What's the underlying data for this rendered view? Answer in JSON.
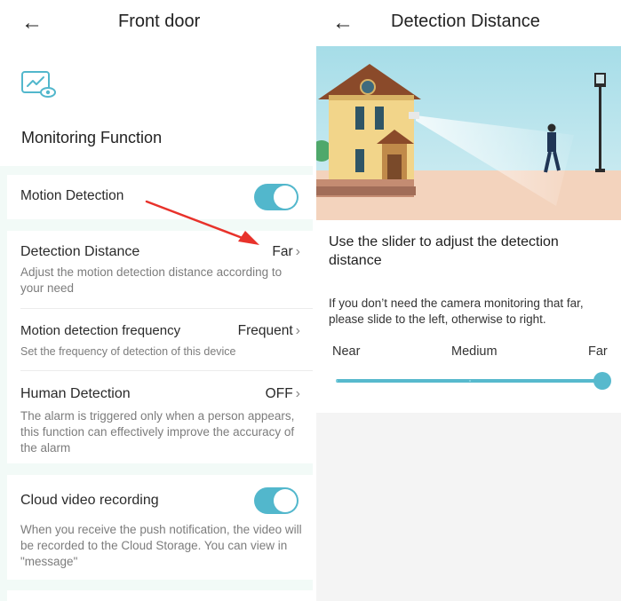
{
  "left": {
    "title": "Front door",
    "section_title": "Monitoring Function",
    "rows": {
      "motion_detection": {
        "title": "Motion Detection",
        "on": true
      },
      "detection_distance": {
        "title": "Detection Distance",
        "value": "Far",
        "desc": "Adjust the motion detection distance according to your need"
      },
      "frequency": {
        "title": "Motion detection frequency",
        "value": "Frequent",
        "desc": "Set the frequency of detection of this device"
      },
      "human_detection": {
        "title": "Human Detection",
        "value": "OFF",
        "desc": "The alarm is triggered only when a person appears, this function can effectively improve the accuracy of the alarm"
      },
      "cloud_recording": {
        "title": "Cloud video recording",
        "on": true,
        "desc": "When you receive the push notification, the video will be recorded to the Cloud Storage. You can view in \"message\""
      }
    }
  },
  "right": {
    "title": "Detection Distance",
    "instruction": "Use the slider to adjust the detection distance",
    "hint": "If you don’t need the camera monitoring that far, please slide to the left, otherwise to right.",
    "labels": {
      "near": "Near",
      "medium": "Medium",
      "far": "Far"
    },
    "selected": "Far"
  },
  "icons": {
    "back": "←",
    "chevron": "›"
  },
  "colors": {
    "accent": "#52b7cc",
    "annotation_arrow": "#e8322b"
  }
}
